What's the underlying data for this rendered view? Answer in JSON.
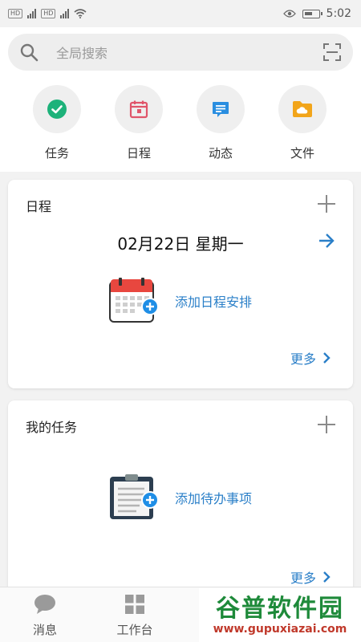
{
  "status_bar": {
    "time": "5:02",
    "sim1": "HD",
    "sim2": "HD",
    "net1": "4G",
    "net2": "4G"
  },
  "search": {
    "placeholder": "全局搜索"
  },
  "quick_actions": [
    {
      "label": "任务",
      "icon": "check-circle-icon",
      "color": "#1db27a"
    },
    {
      "label": "日程",
      "icon": "calendar-icon",
      "color": "#e0556a"
    },
    {
      "label": "动态",
      "icon": "message-icon",
      "color": "#2a8ee0"
    },
    {
      "label": "文件",
      "icon": "folder-cloud-icon",
      "color": "#f2a51a"
    }
  ],
  "schedule_card": {
    "title": "日程",
    "date": "02月22日 星期一",
    "add_label": "添加日程安排",
    "more_label": "更多"
  },
  "tasks_card": {
    "title": "我的任务",
    "add_label": "添加待办事项",
    "more_label": "更多"
  },
  "tab_bar": {
    "tabs": [
      {
        "label": "消息"
      },
      {
        "label": "工作台"
      }
    ]
  },
  "watermark": {
    "text": "谷普软件园",
    "url": "www.gupuxiazai.com"
  },
  "colors": {
    "accent": "#2a7fc8",
    "background": "#f2f2f2"
  }
}
